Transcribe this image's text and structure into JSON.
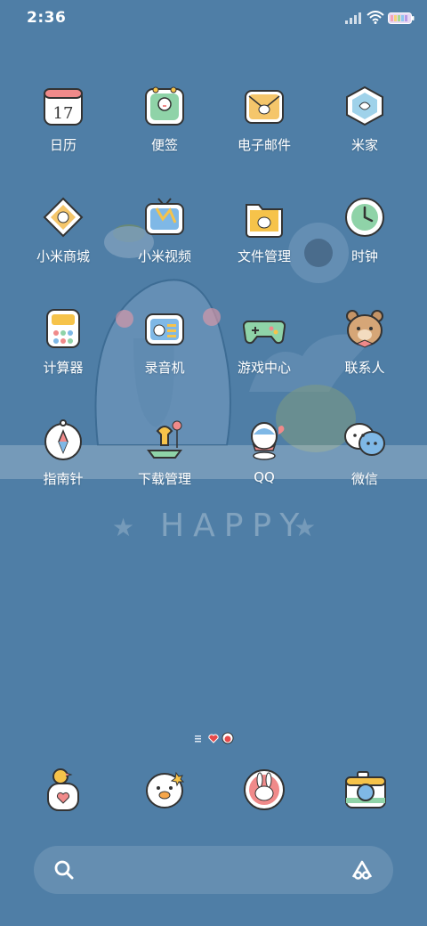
{
  "status_bar": {
    "time": "2:36",
    "battery_color": "#e7d8f3"
  },
  "wallpaper": {
    "banner_text": "HAPPY",
    "background_color": "#4f7ea6"
  },
  "apps": [
    {
      "label": "日历",
      "icon": "calendar-icon",
      "icon_text": "17"
    },
    {
      "label": "便签",
      "icon": "notes-icon"
    },
    {
      "label": "电子邮件",
      "icon": "email-icon"
    },
    {
      "label": "米家",
      "icon": "mijia-icon"
    },
    {
      "label": "小米商城",
      "icon": "mi-store-icon"
    },
    {
      "label": "小米视频",
      "icon": "mi-video-icon"
    },
    {
      "label": "文件管理",
      "icon": "file-manager-icon"
    },
    {
      "label": "时钟",
      "icon": "clock-icon"
    },
    {
      "label": "计算器",
      "icon": "calculator-icon"
    },
    {
      "label": "录音机",
      "icon": "recorder-icon"
    },
    {
      "label": "游戏中心",
      "icon": "game-center-icon"
    },
    {
      "label": "联系人",
      "icon": "contacts-icon"
    },
    {
      "label": "指南针",
      "icon": "compass-icon"
    },
    {
      "label": "下载管理",
      "icon": "download-manager-icon"
    },
    {
      "label": "QQ",
      "icon": "qq-icon"
    },
    {
      "label": "微信",
      "icon": "wechat-icon"
    }
  ],
  "page_indicator": {
    "pages": 3,
    "current": 1
  },
  "dock": [
    {
      "icon": "phone-duck-icon"
    },
    {
      "icon": "messages-bird-icon"
    },
    {
      "icon": "browser-bunny-icon"
    },
    {
      "icon": "camera-icon"
    }
  ],
  "search_bar": {
    "icon": "search-icon",
    "right_icon": "assistant-icon"
  }
}
